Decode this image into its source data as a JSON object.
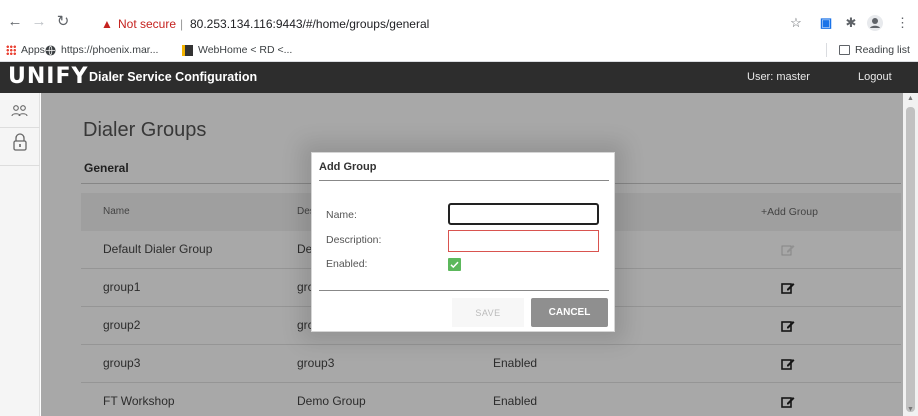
{
  "browser": {
    "security_label": "Not secure",
    "url": "80.253.134.116:9443/#/home/groups/general",
    "bookmarks": [
      {
        "label": "Apps"
      },
      {
        "label": "https://phoenix.mar..."
      },
      {
        "label": "WebHome < RD <..."
      }
    ],
    "reading_list": "Reading list"
  },
  "app": {
    "logo": "UNIFY",
    "title": "Dialer Service Configuration",
    "user": "User:  master",
    "logout": "Logout"
  },
  "page": {
    "title": "Dialer Groups",
    "section": "General",
    "columns": {
      "name": "Name",
      "description": "Des",
      "add_group": "+Add Group"
    },
    "rows": [
      {
        "name": "Default Dialer Group",
        "description": "De",
        "status": ""
      },
      {
        "name": "group1",
        "description": "grc",
        "status": ""
      },
      {
        "name": "group2",
        "description": "grc",
        "status": ""
      },
      {
        "name": "group3",
        "description": "group3",
        "status": "Enabled"
      },
      {
        "name": "FT Workshop",
        "description": "Demo Group",
        "status": "Enabled"
      }
    ]
  },
  "modal": {
    "title": "Add Group",
    "name_label": "Name:",
    "description_label": "Description:",
    "enabled_label": "Enabled:",
    "name_value": "",
    "description_value": "",
    "enabled": true,
    "save_label": "SAVE",
    "cancel_label": "CANCEL"
  },
  "colors": {
    "header_bg": "#2d2d2d",
    "enabled_check": "#5cb85c",
    "invalid_border": "#d9534f",
    "cancel_bg": "#8f8f8f"
  }
}
